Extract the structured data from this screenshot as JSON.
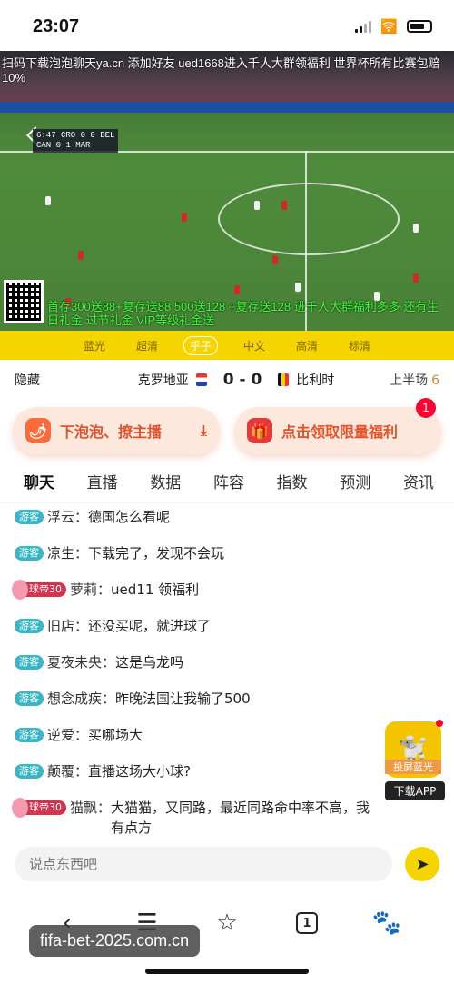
{
  "status_bar": {
    "time": "23:07"
  },
  "video": {
    "top_scroll": "扫码下载泡泡聊天ya.cn 添加好友 ued1668进入千人大群领福利 世界杯所有比赛包赔10%",
    "scoreboard_line1": "6:47 CRO 0 0 BEL",
    "scoreboard_line2": "CAN 0 1 MAR",
    "bottom_scroll": "首存300送88+复存送88 500送128 +复存送128 进千人大群福利多多 还有生日礼金 过节礼金 VIP等级礼金送"
  },
  "quality": {
    "options": [
      "蓝光",
      "超清",
      "乎子",
      "中文",
      "高清",
      "标清"
    ],
    "active_index": 2
  },
  "match": {
    "hide_label": "隐藏",
    "home": "克罗地亚",
    "score": "0 - 0",
    "away": "比利时",
    "period": "上半场",
    "minute": "6"
  },
  "promos": {
    "left": "下泡泡、撩主播",
    "right": "点击领取限量福利",
    "right_badge": "1"
  },
  "tabs": [
    "聊天",
    "直播",
    "数据",
    "阵容",
    "指数",
    "预测",
    "资讯"
  ],
  "chat": [
    {
      "tag": "游客",
      "nick": "浮云：",
      "text": "德国怎么看呢"
    },
    {
      "tag": "游客",
      "nick": "凉生：",
      "text": "下载完了，发现不会玩"
    },
    {
      "tag": "球帝30",
      "nick": "萝莉：",
      "text": "ued11 领福利"
    },
    {
      "tag": "游客",
      "nick": "旧店：",
      "text": "还没买呢，就进球了"
    },
    {
      "tag": "游客",
      "nick": "夏夜未央：",
      "text": "这是乌龙吗"
    },
    {
      "tag": "游客",
      "nick": "想念成疾：",
      "text": "昨晚法国让我输了500"
    },
    {
      "tag": "游客",
      "nick": "逆爱：",
      "text": "买哪场大"
    },
    {
      "tag": "游客",
      "nick": "颠覆：",
      "text": "直播这场大小球?"
    },
    {
      "tag": "球帝30",
      "nick": "猫飘：",
      "text": "大猫猫，又同路，最近同路命中率不高，我有点方"
    }
  ],
  "floating_app": {
    "caption": "投屏蓝光",
    "label": "下载APP"
  },
  "input": {
    "placeholder": "说点东西吧"
  },
  "nav": {
    "tab_count": "1"
  },
  "watermark": "fifa-bet-2025.com.cn"
}
